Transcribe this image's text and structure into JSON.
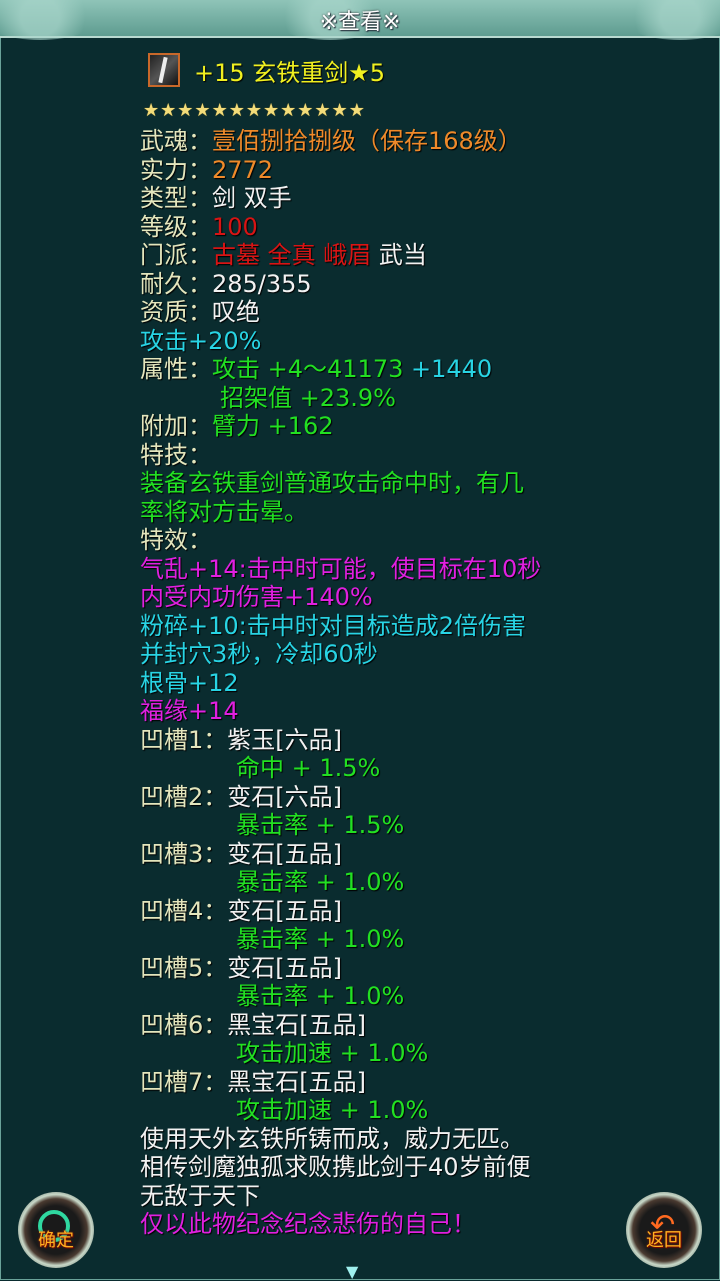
{
  "header": {
    "title": "※查看※"
  },
  "item": {
    "name": "+15 玄铁重剑★5",
    "icon": "sword-icon",
    "star_count": 13
  },
  "lines": [
    [
      {
        "t": "武魂：",
        "c": "label"
      },
      {
        "t": "壹佰捌拾捌级（保存168级）",
        "c": "orange"
      }
    ],
    [
      {
        "t": "实力：",
        "c": "label"
      },
      {
        "t": "2772",
        "c": "orange"
      }
    ],
    [
      {
        "t": "类型：",
        "c": "label"
      },
      {
        "t": "剑 双手",
        "c": "white"
      }
    ],
    [
      {
        "t": "等级：",
        "c": "label"
      },
      {
        "t": "100",
        "c": "red"
      }
    ],
    [
      {
        "t": "门派：",
        "c": "label"
      },
      {
        "t": "古墓 全真 峨眉 ",
        "c": "red"
      },
      {
        "t": "武当",
        "c": "white"
      }
    ],
    [
      {
        "t": "耐久：",
        "c": "label"
      },
      {
        "t": "285/355",
        "c": "white"
      }
    ],
    [
      {
        "t": "资质：",
        "c": "label"
      },
      {
        "t": "叹绝",
        "c": "white"
      }
    ],
    [
      {
        "t": "攻击+20%",
        "c": "cyan"
      }
    ],
    [
      {
        "t": "属性：",
        "c": "label"
      },
      {
        "t": "攻击 +4～41173 ",
        "c": "green"
      },
      {
        "t": "+1440",
        "c": "cyan"
      }
    ],
    [
      {
        "t": "",
        "c": "indent"
      },
      {
        "t": "招架值 +23.9%",
        "c": "green"
      }
    ],
    [
      {
        "t": "附加：",
        "c": "label"
      },
      {
        "t": "臂力 +162",
        "c": "green"
      }
    ],
    [
      {
        "t": "特技：",
        "c": "label"
      }
    ],
    [
      {
        "t": "装备玄铁重剑普通攻击命中时，有几",
        "c": "green"
      }
    ],
    [
      {
        "t": "率将对方击晕。",
        "c": "green"
      }
    ],
    [
      {
        "t": "特效：",
        "c": "label"
      }
    ],
    [
      {
        "t": "气乱+14:击中时可能，使目标在10秒",
        "c": "magenta"
      }
    ],
    [
      {
        "t": "内受内功伤害+140%",
        "c": "magenta"
      }
    ],
    [
      {
        "t": "粉碎+10:击中时对目标造成2倍伤害",
        "c": "cyan"
      }
    ],
    [
      {
        "t": "并封穴3秒，冷却60秒",
        "c": "cyan"
      }
    ],
    [
      {
        "t": "根骨+12",
        "c": "cyan"
      }
    ],
    [
      {
        "t": "福缘+14",
        "c": "magenta"
      }
    ],
    [
      {
        "t": "凹槽1：",
        "c": "label"
      },
      {
        "t": "紫玉[六品]",
        "c": "white"
      }
    ],
    [
      {
        "t": "",
        "c": "indent2"
      },
      {
        "t": "命中 + 1.5%",
        "c": "green"
      }
    ],
    [
      {
        "t": "凹槽2：",
        "c": "label"
      },
      {
        "t": "变石[六品]",
        "c": "white"
      }
    ],
    [
      {
        "t": "",
        "c": "indent2"
      },
      {
        "t": "暴击率 + 1.5%",
        "c": "green"
      }
    ],
    [
      {
        "t": "凹槽3：",
        "c": "label"
      },
      {
        "t": "变石[五品]",
        "c": "white"
      }
    ],
    [
      {
        "t": "",
        "c": "indent2"
      },
      {
        "t": "暴击率 + 1.0%",
        "c": "green"
      }
    ],
    [
      {
        "t": "凹槽4：",
        "c": "label"
      },
      {
        "t": "变石[五品]",
        "c": "white"
      }
    ],
    [
      {
        "t": "",
        "c": "indent2"
      },
      {
        "t": "暴击率 + 1.0%",
        "c": "green"
      }
    ],
    [
      {
        "t": "凹槽5：",
        "c": "label"
      },
      {
        "t": "变石[五品]",
        "c": "white"
      }
    ],
    [
      {
        "t": "",
        "c": "indent2"
      },
      {
        "t": "暴击率 + 1.0%",
        "c": "green"
      }
    ],
    [
      {
        "t": "凹槽6：",
        "c": "label"
      },
      {
        "t": "黑宝石[五品]",
        "c": "white"
      }
    ],
    [
      {
        "t": "",
        "c": "indent2"
      },
      {
        "t": "攻击加速 + 1.0%",
        "c": "green"
      }
    ],
    [
      {
        "t": "凹槽7：",
        "c": "label"
      },
      {
        "t": "黑宝石[五品]",
        "c": "white"
      }
    ],
    [
      {
        "t": "",
        "c": "indent2"
      },
      {
        "t": "攻击加速 + 1.0%",
        "c": "green"
      }
    ],
    [
      {
        "t": "使用天外玄铁所铸而成，威力无匹。",
        "c": "white"
      }
    ],
    [
      {
        "t": "相传剑魔独孤求败携此剑于40岁前便",
        "c": "white"
      }
    ],
    [
      {
        "t": "无敌于天下",
        "c": "white"
      }
    ],
    [
      {
        "t": "仅以此物纪念纪念悲伤的自己！",
        "c": "magenta"
      }
    ]
  ],
  "buttons": {
    "confirm": "确定",
    "back": "返回"
  },
  "colors": {
    "background": "#0a2c2f",
    "label": "#e4e6bd",
    "orange": "#ef8a2a",
    "red": "#d81414",
    "cyan": "#28d4e4",
    "green": "#22e022",
    "magenta": "#e020e0",
    "title_yellow": "#f0f020"
  }
}
